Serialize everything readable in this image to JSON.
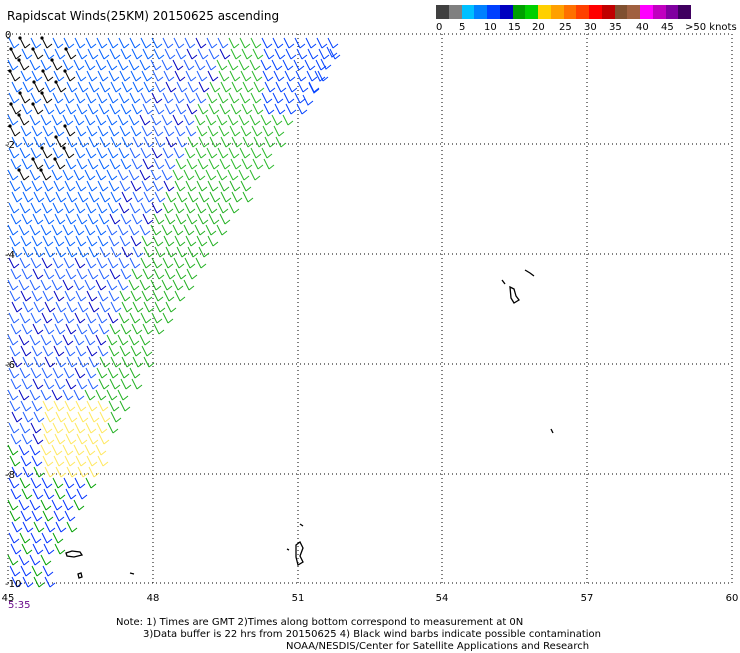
{
  "title": "Rapidscat Winds(25KM) 20150625 ascending",
  "legend": {
    "colors": [
      "#404040",
      "#808080",
      "#00c0ff",
      "#0080ff",
      "#0040ff",
      "#0000c0",
      "#00a000",
      "#00d000",
      "#ffd000",
      "#ffa000",
      "#ff7000",
      "#ff4000",
      "#ff0000",
      "#c00000",
      "#805030",
      "#a06040",
      "#ff00ff",
      "#c000c0",
      "#8000a0",
      "#400060"
    ],
    "labels": [
      "0",
      "5",
      "10",
      "15",
      "20",
      "25",
      "30",
      "35",
      "40",
      "45",
      ">50 knots"
    ]
  },
  "axes": {
    "x_ticks": [
      "45",
      "48",
      "51",
      "54",
      "57",
      "60"
    ],
    "y_ticks": [
      "0",
      "-2",
      "-4",
      "-6",
      "-8",
      "-10"
    ]
  },
  "time_label": "5:35",
  "notes": [
    "Note: 1) Times are GMT 2)Times along bottom correspond to measurement at 0N",
    "3)Data buffer is 22 hrs from 20150625 4) Black wind barbs indicate possible contamination",
    "NOAA/NESDIS/Center for Satellite Applications and Research"
  ]
}
